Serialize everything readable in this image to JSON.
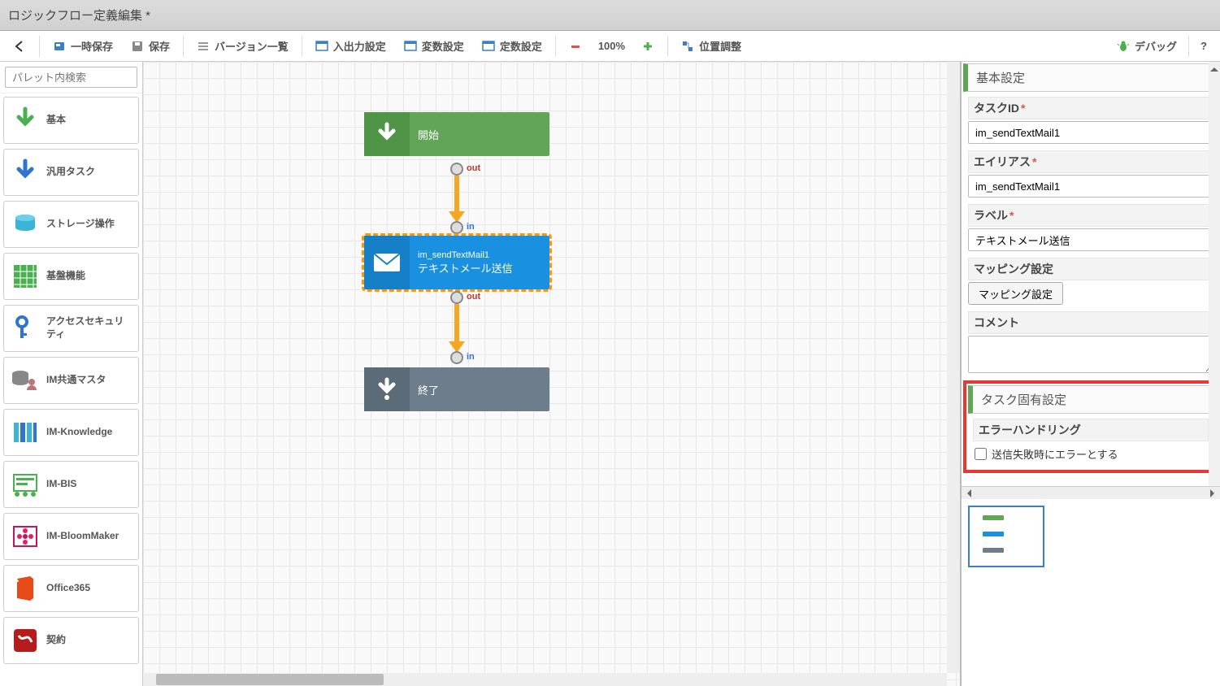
{
  "title": "ロジックフロー定義編集  *",
  "toolbar": {
    "back": "",
    "temp_save": "一時保存",
    "save": "保存",
    "version_list": "バージョン一覧",
    "io_settings": "入出力設定",
    "var_settings": "変数設定",
    "const_settings": "定数設定",
    "zoom": "100%",
    "align": "位置調整",
    "debug": "デバッグ",
    "help": "?"
  },
  "palette": {
    "search_placeholder": "パレット内検索",
    "items": [
      {
        "label": "基本"
      },
      {
        "label": "汎用タスク"
      },
      {
        "label": "ストレージ操作"
      },
      {
        "label": "基盤機能"
      },
      {
        "label": "アクセスセキュリティ"
      },
      {
        "label": "IM共通マスタ"
      },
      {
        "label": "IM-Knowledge"
      },
      {
        "label": "IM-BIS"
      },
      {
        "label": "IM-BloomMaker"
      },
      {
        "label": "Office365"
      },
      {
        "label": "契約"
      }
    ]
  },
  "flow": {
    "start": {
      "label": "開始",
      "out": "out"
    },
    "mail": {
      "id": "im_sendTextMail1",
      "label": "テキストメール送信",
      "in": "in",
      "out": "out"
    },
    "end": {
      "label": "終了",
      "in": "in"
    }
  },
  "panel": {
    "basic_header": "基本設定",
    "task_id_label": "タスクID",
    "task_id_value": "im_sendTextMail1",
    "alias_label": "エイリアス",
    "alias_value": "im_sendTextMail1",
    "label_label": "ラベル",
    "label_value": "テキストメール送信",
    "mapping_label": "マッピング設定",
    "mapping_button": "マッピング設定",
    "comment_label": "コメント",
    "comment_value": "",
    "task_specific_header": "タスク固有設定",
    "error_handling_label": "エラーハンドリング",
    "error_checkbox_label": "送信失敗時にエラーとする",
    "error_checkbox_checked": false
  }
}
